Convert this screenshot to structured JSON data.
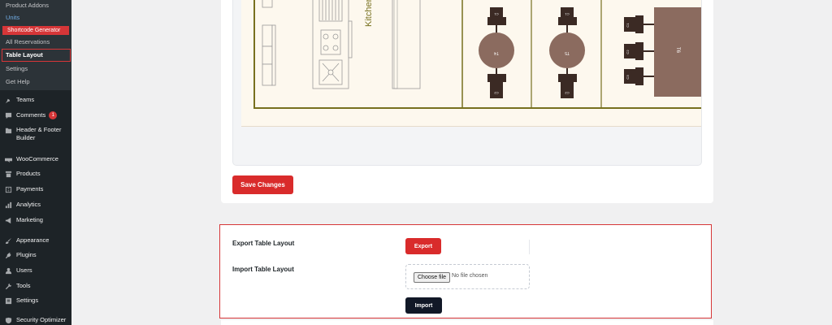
{
  "sidebar": {
    "submenu": [
      {
        "label": "Product Addons"
      },
      {
        "label": "Units"
      },
      {
        "label": "Shortcode Generator"
      },
      {
        "label": "All Reservations"
      },
      {
        "label": "Table Layout"
      },
      {
        "label": "Settings"
      },
      {
        "label": "Get Help"
      }
    ],
    "menu": [
      {
        "label": "Teams",
        "icon": "pin-icon"
      },
      {
        "label": "Comments",
        "icon": "comment-icon",
        "badge": "1"
      },
      {
        "label": "Header & Footer Builder",
        "icon": "folder-icon"
      },
      {
        "label": "WooCommerce",
        "icon": "woo-icon"
      },
      {
        "label": "Products",
        "icon": "archive-icon"
      },
      {
        "label": "Payments",
        "icon": "dollar-icon"
      },
      {
        "label": "Analytics",
        "icon": "bar-chart-icon"
      },
      {
        "label": "Marketing",
        "icon": "megaphone-icon"
      },
      {
        "label": "Appearance",
        "icon": "brush-icon"
      },
      {
        "label": "Plugins",
        "icon": "plug-icon"
      },
      {
        "label": "Users",
        "icon": "user-icon"
      },
      {
        "label": "Tools",
        "icon": "wrench-icon"
      },
      {
        "label": "Settings",
        "icon": "sliders-icon"
      },
      {
        "label": "Security Optimizer",
        "icon": "shield-icon"
      }
    ]
  },
  "floor": {
    "kitchen_label": "Kitchen",
    "tables": [
      {
        "label": "T4"
      },
      {
        "label": "T5"
      },
      {
        "label": "T6"
      }
    ],
    "chair_labels": [
      "C1",
      "C2",
      "C1",
      "C2",
      "C1",
      "C2",
      "C3"
    ]
  },
  "layout": {
    "save_label": "Save Changes"
  },
  "export_import": {
    "export_title": "Export Table Layout",
    "export_button": "Export",
    "import_title": "Import Table Layout",
    "choose_file": "Choose file",
    "no_file": "No file chosen",
    "import_button": "Import"
  },
  "colors": {
    "sidebar_bg": "#1d2327",
    "accent_red": "#d92b2b",
    "highlight_border": "#d63638",
    "table_brown": "#8b6b5f",
    "chair_dark": "#3b2a24",
    "wall_olive": "#77701f",
    "import_dark": "#111827"
  }
}
